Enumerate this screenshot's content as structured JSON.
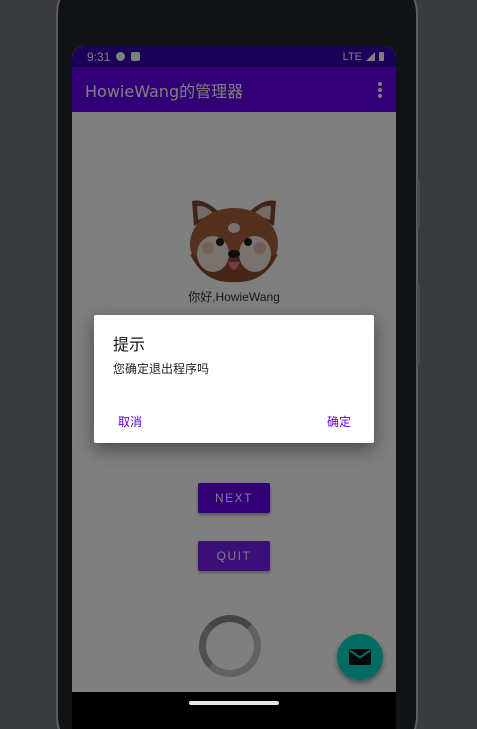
{
  "status_bar": {
    "time": "9:31",
    "network": "LTE"
  },
  "app_bar": {
    "title": "HowieWang的管理器",
    "overflow_icon": "more-vert-icon"
  },
  "main": {
    "avatar_icon": "red-panda-icon",
    "greeting": "你好,HowieWang",
    "next_label": "NEXT",
    "quit_label": "QUIT",
    "fab_icon": "mail-icon"
  },
  "dialog": {
    "title": "提示",
    "message": "您确定退出程序吗",
    "cancel_label": "取消",
    "confirm_label": "确定"
  },
  "colors": {
    "status_bar": "#3700b3",
    "primary": "#6200ee",
    "accent": "#03dac5",
    "scrim": "rgba(0,0,0,0.5)"
  }
}
